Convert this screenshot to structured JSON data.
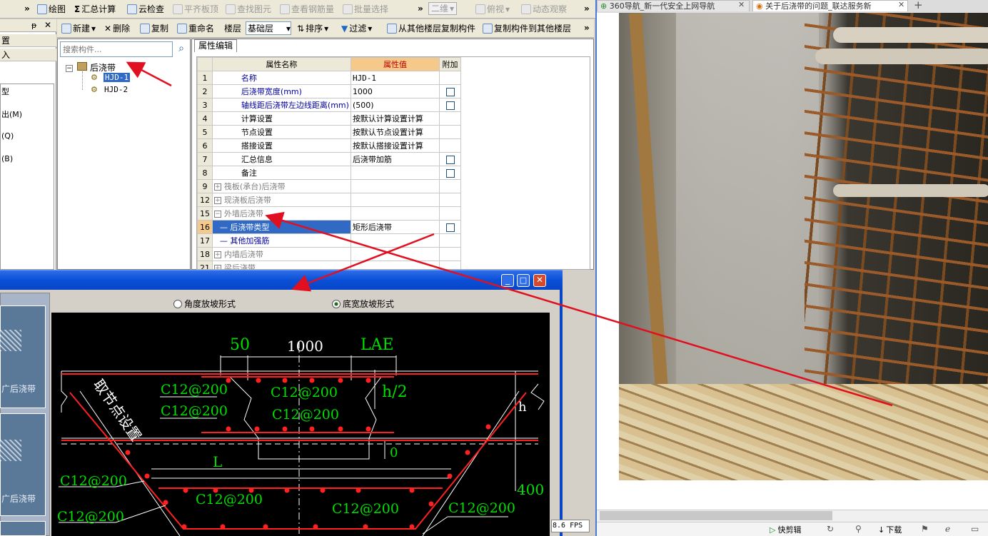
{
  "toolbar1": {
    "draw": "绘图",
    "sum": "汇总计算",
    "cloud_check": "云检查",
    "flat_slab": "平齐板顶",
    "find": "查找图元",
    "view_rebar": "查看钢筋量",
    "batch_select": "批量选择",
    "dim": "二维",
    "view": "俯视",
    "dyn_view": "动态观察"
  },
  "toolbar2": {
    "new": "新建",
    "delete": "删除",
    "copy": "复制",
    "rename": "重命名",
    "floor_label": "楼层",
    "floor_value": "基础层",
    "sort": "排序",
    "filter": "过滤",
    "copy_from": "从其他楼层复制构件",
    "copy_to": "复制构件到其他楼层"
  },
  "left_panel": {
    "items": [
      "置",
      "入",
      "型",
      "出(M)",
      "",
      "(Q)",
      "(B)"
    ]
  },
  "search": {
    "placeholder": "搜索构件..."
  },
  "tree": {
    "root": "后浇带",
    "children": [
      "HJD-1",
      "HJD-2"
    ]
  },
  "prop_tab": "属性编辑",
  "table": {
    "headers": [
      "属性名称",
      "属性值",
      "附加"
    ],
    "rows": [
      {
        "n": "1",
        "name": "名称",
        "value": "HJD-1",
        "cb": false
      },
      {
        "n": "2",
        "name": "后浇带宽度(mm)",
        "value": "1000",
        "cb": true
      },
      {
        "n": "3",
        "name": "轴线距后浇带左边线距离(mm)",
        "value": "(500)",
        "cb": true
      },
      {
        "n": "4",
        "name": "计算设置",
        "value": "按默认计算设置计算",
        "cb": false
      },
      {
        "n": "5",
        "name": "节点设置",
        "value": "按默认节点设置计算",
        "cb": false
      },
      {
        "n": "6",
        "name": "搭接设置",
        "value": "按默认搭接设置计算",
        "cb": false
      },
      {
        "n": "7",
        "name": "汇总信息",
        "value": "后浇带加筋",
        "cb": true
      },
      {
        "n": "8",
        "name": "备注",
        "value": "",
        "cb": true
      },
      {
        "n": "9",
        "name": "筏板(承台)后浇带",
        "value": "",
        "cb": false
      },
      {
        "n": "12",
        "name": "现浇板后浇带",
        "value": "",
        "cb": false
      },
      {
        "n": "15",
        "name": "外墙后浇带",
        "value": "",
        "cb": false
      },
      {
        "n": "16",
        "name": "后浇带类型",
        "value": "矩形后浇带",
        "cb": true
      },
      {
        "n": "17",
        "name": "其他加强筋",
        "value": "",
        "cb": false
      },
      {
        "n": "18",
        "name": "内墙后浇带",
        "value": "",
        "cb": false
      },
      {
        "n": "21",
        "name": "梁后浇带",
        "value": "",
        "cb": false
      }
    ]
  },
  "dialog": {
    "radio1": "角度放坡形式",
    "radio2": "底宽放坡形式",
    "thumb1": "广后浇带",
    "thumb2": "广后浇带",
    "cad": {
      "dim50": "50",
      "dim1000": "1000",
      "dimLAE": "LAE",
      "h2": "h/2",
      "h": "h",
      "zero": "0",
      "L": "L",
      "d400": "400",
      "rebar": "C12@200",
      "node_label": "取节点设置"
    },
    "fps": "8.6 FPS"
  },
  "browser": {
    "tab1": "360导航_新一代安全上网导航",
    "tab2": "关于后浇带的问题_联达服务新",
    "status": {
      "quick_clip": "快剪辑",
      "download": "下载"
    }
  },
  "colors": {
    "cad_bg": "#000000",
    "cad_green": "#00e000",
    "cad_red": "#ff2020",
    "annotation_red": "#e01020",
    "selection": "#316ac5",
    "title_blue": "#0a4fd8"
  }
}
